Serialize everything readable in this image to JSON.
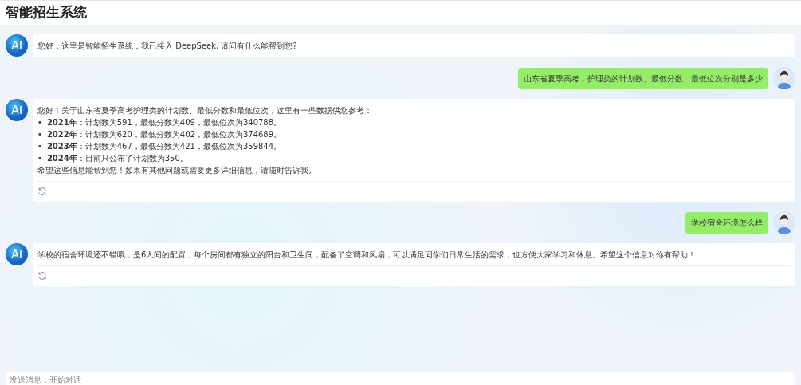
{
  "header": {
    "title": "智能招生系统"
  },
  "messages": [
    {
      "kind": "ai",
      "text": "您好，这里是智能招生系统，我已接入 DeepSeek, 请问有什么能帮到您?",
      "regenerate": false
    },
    {
      "kind": "user",
      "text": "山东省夏季高考，护理类的计划数、最低分数、最低位次分别是多少"
    },
    {
      "kind": "ai",
      "text": "您好！关于山东省夏季高考护理类的计划数、最低分数和最低位次，这里有一些数据供您参考：",
      "items": [
        {
          "bullet": "•",
          "text": "**2021年**：计划数为591，最低分数为409，最低位次为340788。"
        },
        {
          "bullet": "•",
          "text": "**2022年**：计划数为620，最低分数为402，最低位次为374689。"
        },
        {
          "bullet": "•",
          "text": "**2023年**：计划数为467，最低分数为421，最低位次为359844。"
        },
        {
          "bullet": "•",
          "text": "**2024年**：目前只公布了计划数为350。"
        }
      ],
      "closing": "希望这些信息能帮到您！如果有其他问题或需要更多详细信息，请随时告诉我。",
      "regenerate": true
    },
    {
      "kind": "user",
      "text": "学校宿舍环境怎么样"
    },
    {
      "kind": "ai",
      "text": "学校的宿舍环境还不错哦，是6人间的配置，每个房间都有独立的阳台和卫生间，配备了空调和风扇，可以满足同学们日常生活的需求，也方便大家学习和休息。希望这个信息对你有帮助！",
      "regenerate": true
    }
  ],
  "composer": {
    "placeholder": "发送消息，开始对话"
  }
}
